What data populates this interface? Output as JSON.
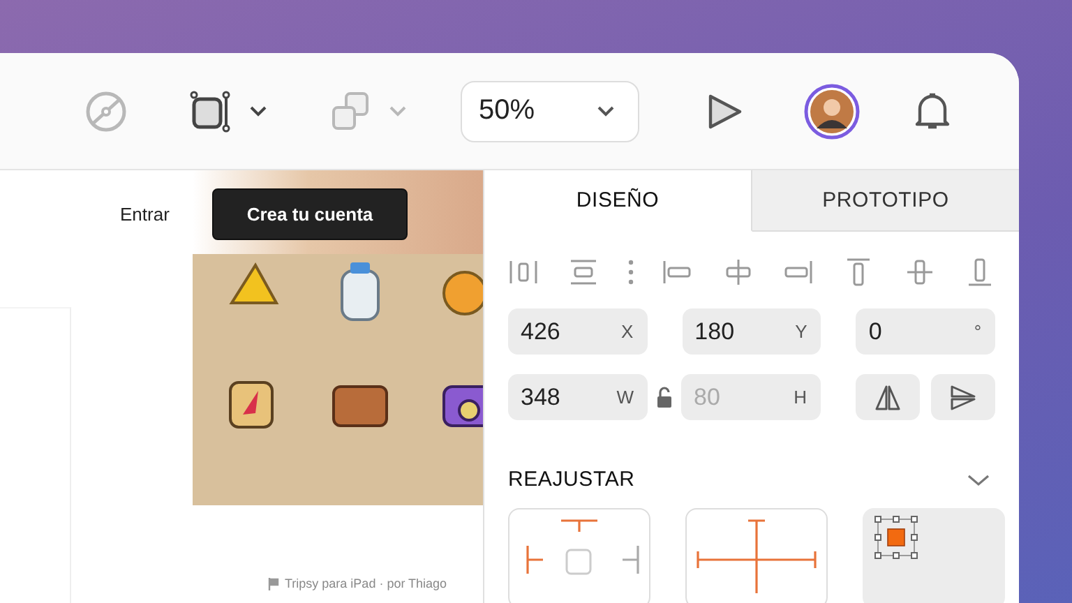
{
  "toolbar": {
    "tools": [
      {
        "kind": "path",
        "disabled": true,
        "menu": false
      },
      {
        "kind": "frame",
        "disabled": false,
        "menu": true
      },
      {
        "kind": "boolean",
        "disabled": true,
        "menu": true
      }
    ],
    "zoom": "50%"
  },
  "canvas": {
    "login": "Entrar",
    "signup": "Crea tu cuenta",
    "footer": "Tripsy para iPad · por Thiago"
  },
  "panel": {
    "tabs": [
      {
        "label": "DISEÑO",
        "selected": true
      },
      {
        "label": "PROTOTIPO",
        "selected": false
      }
    ],
    "fields": [
      {
        "value": "426",
        "unit": "X",
        "disabled": false
      },
      {
        "value": "180",
        "unit": "Y",
        "disabled": false
      },
      {
        "value": "0",
        "unit": "°",
        "disabled": false
      },
      {
        "value": "348",
        "unit": "W",
        "disabled": false
      },
      {
        "value": "80",
        "unit": "H",
        "disabled": true
      }
    ],
    "section": "REAJUSTAR",
    "resize": [
      {
        "kind": "pin",
        "selected": false
      },
      {
        "kind": "stretch",
        "selected": false
      },
      {
        "kind": "handles",
        "selected": true
      }
    ]
  }
}
